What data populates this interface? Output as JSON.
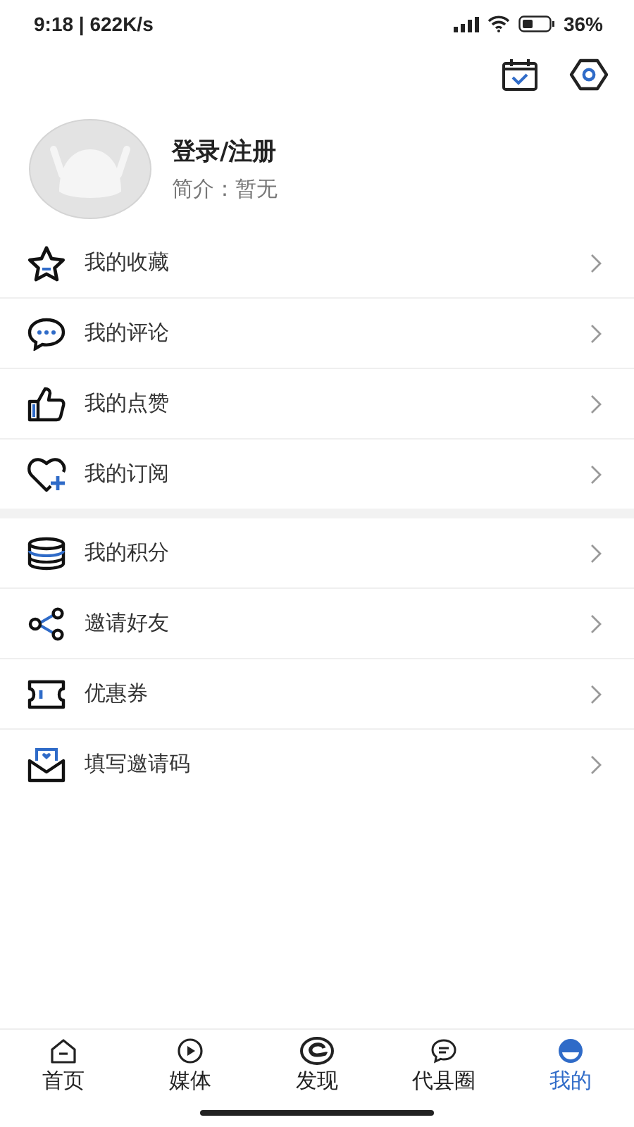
{
  "status_bar": {
    "time": "9:18 | 622K/s",
    "battery": "36%"
  },
  "profile": {
    "name": "登录/注册",
    "bio": "简介：暂无"
  },
  "menu_groups": [
    {
      "items": [
        {
          "label": "我的收藏"
        },
        {
          "label": "我的评论"
        },
        {
          "label": "我的点赞"
        },
        {
          "label": "我的订阅"
        }
      ]
    },
    {
      "items": [
        {
          "label": "我的积分"
        },
        {
          "label": "邀请好友"
        },
        {
          "label": "优惠券"
        },
        {
          "label": "填写邀请码"
        }
      ]
    }
  ],
  "tab_bar": [
    {
      "label": "首页",
      "selected": false
    },
    {
      "label": "媒体",
      "selected": false
    },
    {
      "label": "发现",
      "selected": false
    },
    {
      "label": "代县圈",
      "selected": false
    },
    {
      "label": "我的",
      "selected": true
    }
  ]
}
